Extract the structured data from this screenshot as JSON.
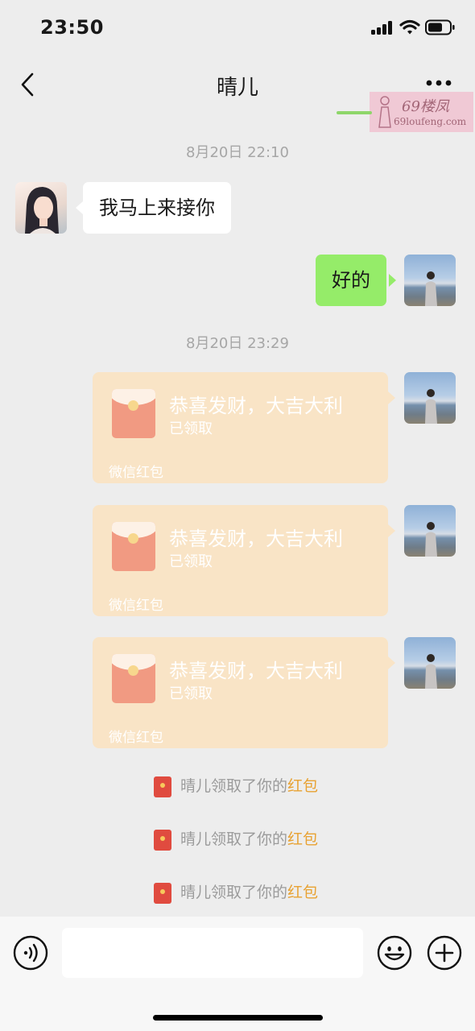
{
  "status_bar": {
    "time": "23:50"
  },
  "header": {
    "title": "晴儿"
  },
  "watermark": {
    "text": "69楼凤",
    "url": "69loufeng.com"
  },
  "messages": [
    {
      "type": "timestamp",
      "text": "8月20日 22:10"
    },
    {
      "type": "text",
      "side": "incoming",
      "text": "我马上来接你"
    },
    {
      "type": "text",
      "side": "outgoing",
      "text": "好的"
    },
    {
      "type": "timestamp",
      "text": "8月20日 23:29"
    },
    {
      "type": "red_packet",
      "side": "outgoing",
      "title": "恭喜发财，大吉大利",
      "status": "已领取",
      "footer": "微信红包"
    },
    {
      "type": "red_packet",
      "side": "outgoing",
      "title": "恭喜发财，大吉大利",
      "status": "已领取",
      "footer": "微信红包"
    },
    {
      "type": "red_packet",
      "side": "outgoing",
      "title": "恭喜发财，大吉大利",
      "status": "已领取",
      "footer": "微信红包"
    },
    {
      "type": "system",
      "text": "晴儿领取了你的",
      "link": "红包"
    },
    {
      "type": "system",
      "text": "晴儿领取了你的",
      "link": "红包"
    },
    {
      "type": "system",
      "text": "晴儿领取了你的",
      "link": "红包"
    }
  ],
  "input_bar": {
    "value": ""
  },
  "colors": {
    "background": "#ededed",
    "outgoing_bubble": "#95ec69",
    "incoming_bubble": "#ffffff",
    "red_packet_opened": "#f9e4c6",
    "link": "#e8a233"
  }
}
